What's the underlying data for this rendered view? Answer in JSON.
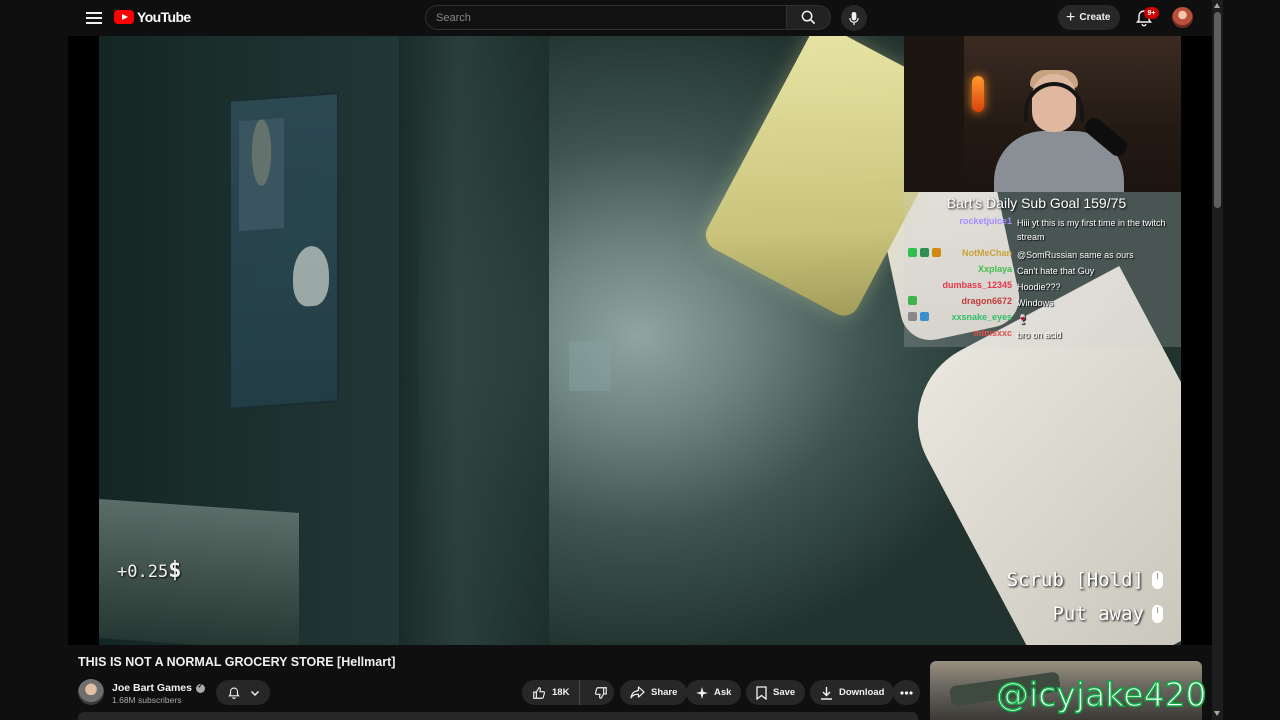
{
  "app": {
    "logo_text": "YouTube",
    "brand_color": "#ff0000"
  },
  "header": {
    "search_placeholder": "Search",
    "create_label": "Create",
    "notification_count": "9+"
  },
  "video": {
    "money_text": "+0.25",
    "money_symbol": "$",
    "hint_scrub": "Scrub [Hold]",
    "hint_put_away": "Put away",
    "overlay": {
      "sub_goal": "Bart's Daily Sub Goal 159/75",
      "chat": [
        {
          "user": "rocketjuice1",
          "user_color": "#a58cff",
          "message": "Hiii yt this is my first time in the twitch stream",
          "badges": []
        },
        {
          "user": "NotMeChan",
          "user_color": "#c8a23c",
          "message": "@SomRussian same as ours",
          "badges": [
            "#2fbf50",
            "#2f8f50",
            "#d08a10"
          ]
        },
        {
          "user": "Xxplaya",
          "user_color": "#3fbf4a",
          "message": "Can't hate that Guy",
          "badges": []
        },
        {
          "user": "dumbass_12345",
          "user_color": "#e8344a",
          "message": "Hoodie???",
          "badges": []
        },
        {
          "user": "dragon6672",
          "user_color": "#c23a3a",
          "message": "Windows",
          "badges": [
            "#3bb54a"
          ]
        },
        {
          "user": "xxsnake_eyes",
          "user_color": "#2fbf6a",
          "message": "🍷",
          "badges": [
            "#888888",
            "#3a8fd0"
          ]
        },
        {
          "user": "mimsxxc",
          "user_color": "#e0504a",
          "message": "bro on acid",
          "badges": []
        }
      ]
    }
  },
  "meta": {
    "title": "THIS IS NOT A NORMAL GROCERY STORE [Hellmart]",
    "channel_name": "Joe Bart Games",
    "subscribers": "1.68M subscribers",
    "likes": "18K",
    "share_label": "Share",
    "ask_label": "Ask",
    "save_label": "Save",
    "download_label": "Download"
  },
  "watermark": "@icyjake420"
}
